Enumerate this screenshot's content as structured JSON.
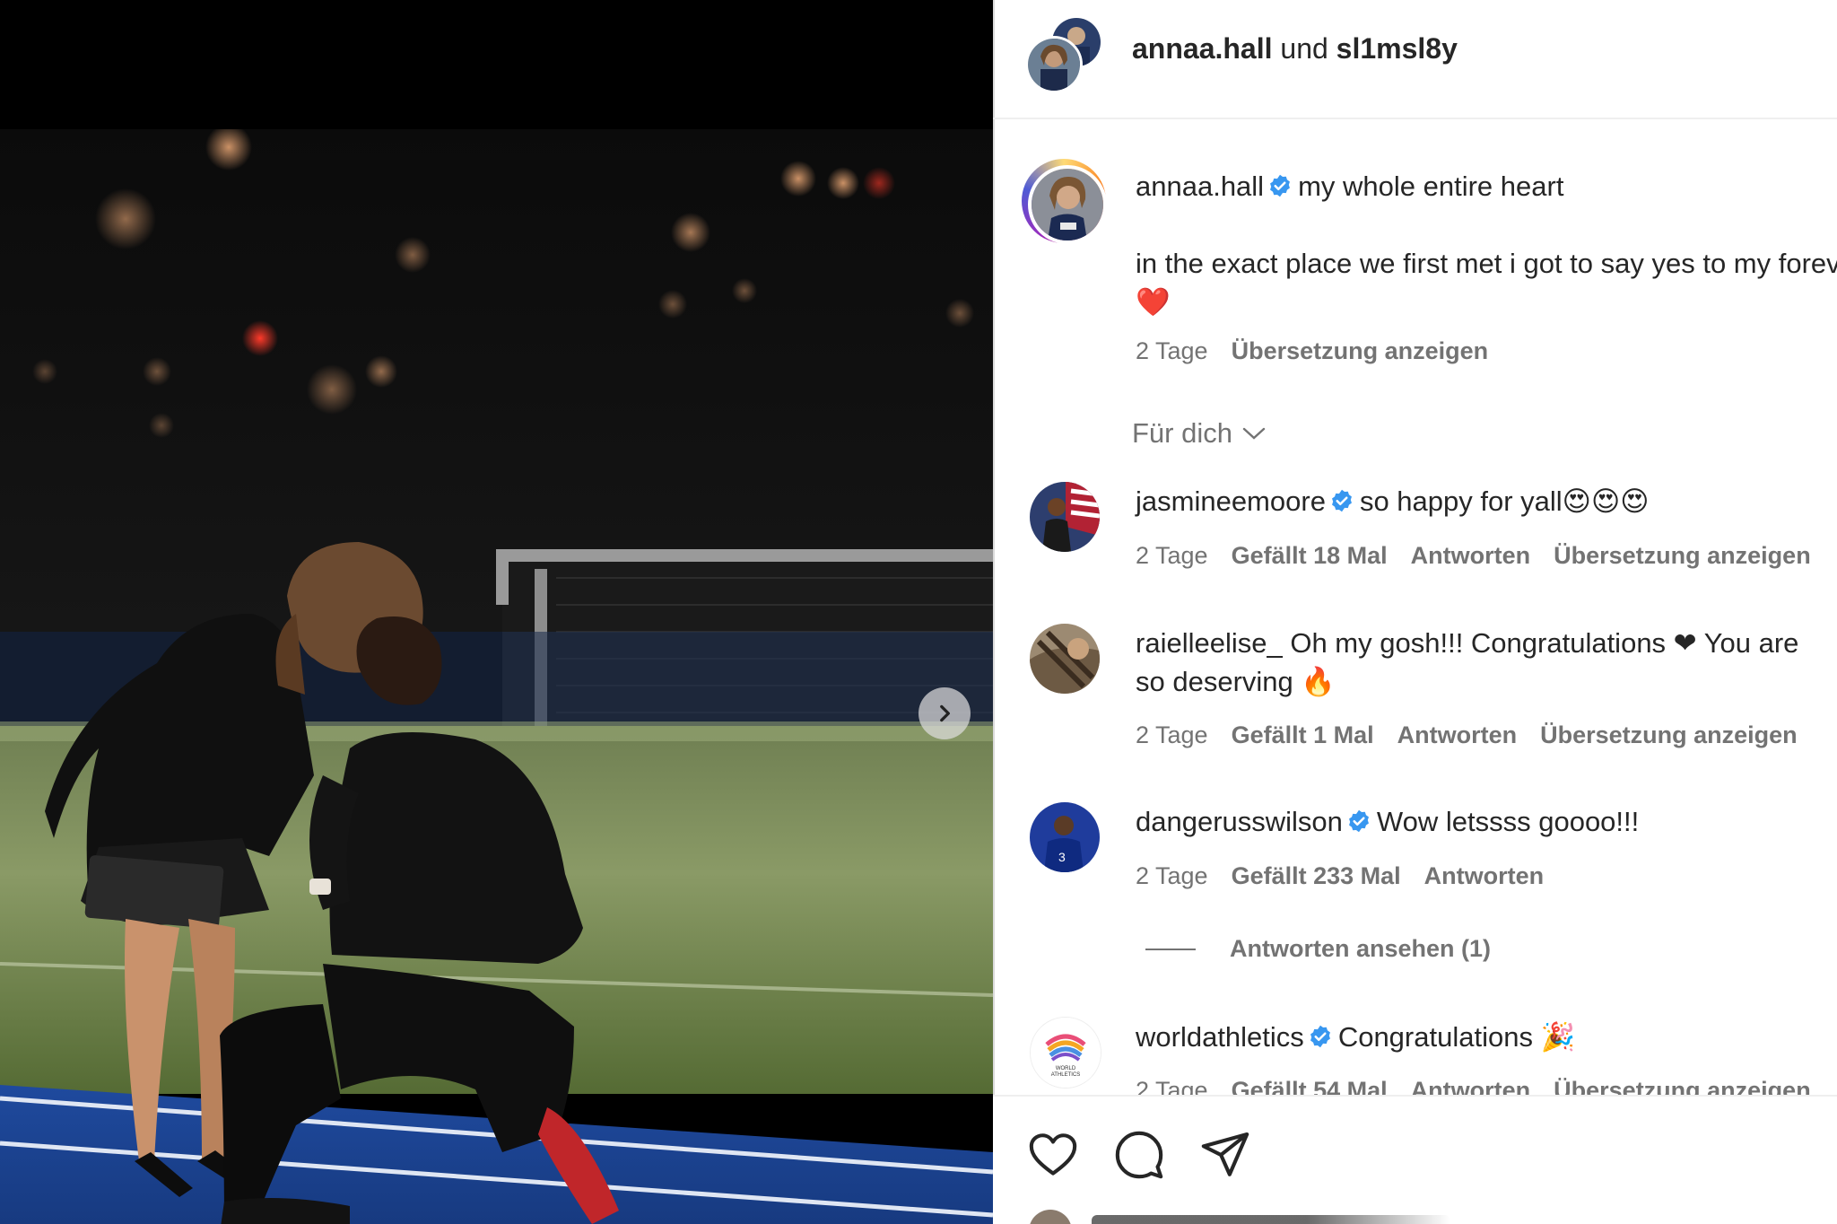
{
  "post": {
    "header": {
      "user1": "annaa.hall",
      "conj": "und",
      "user2": "sl1msl8y"
    },
    "caption": {
      "username": "annaa.hall",
      "text_first": "my whole entire heart",
      "text_body": "in the exact place we first met i got to say yes to my forever ❤️",
      "time": "2 Tage",
      "translate": "Übersetzung anzeigen"
    },
    "sort_label": "Für dich",
    "comments": [
      {
        "username": "jasmineemoore",
        "verified": true,
        "text": "so happy for yall😍😍😍",
        "time": "2 Tage",
        "likes": "Gefällt 18 Mal",
        "reply": "Antworten",
        "translate": "Übersetzung anzeigen"
      },
      {
        "username": "raielleelise_",
        "verified": false,
        "text": "Oh my gosh!!! Congratulations ❤ You are so deserving 🔥",
        "time": "2 Tage",
        "likes": "Gefällt 1 Mal",
        "reply": "Antworten",
        "translate": "Übersetzung anzeigen"
      },
      {
        "username": "dangerusswilson",
        "verified": true,
        "text": "Wow letssss goooo!!!",
        "time": "2 Tage",
        "likes": "Gefällt 233 Mal",
        "reply": "Antworten"
      },
      {
        "username": "worldathletics",
        "verified": true,
        "text": "Congratulations 🎉",
        "time": "2 Tage",
        "likes": "Gefällt 54 Mal",
        "reply": "Antworten",
        "translate": "Übersetzung anzeigen"
      }
    ],
    "view_replies": "Antworten ansehen (1)",
    "worldathletics_logo_text": "WORLD ATHLETICS"
  },
  "icons": {
    "next": "chevron-right-icon",
    "verified": "verified-badge-icon",
    "like": "heart-icon",
    "comment": "comment-bubble-icon",
    "share": "paper-plane-icon",
    "sort": "chevron-down-icon"
  },
  "colors": {
    "verified": "#3897f0",
    "text": "#262626",
    "meta": "#737373",
    "track": "#1e3f8f"
  }
}
